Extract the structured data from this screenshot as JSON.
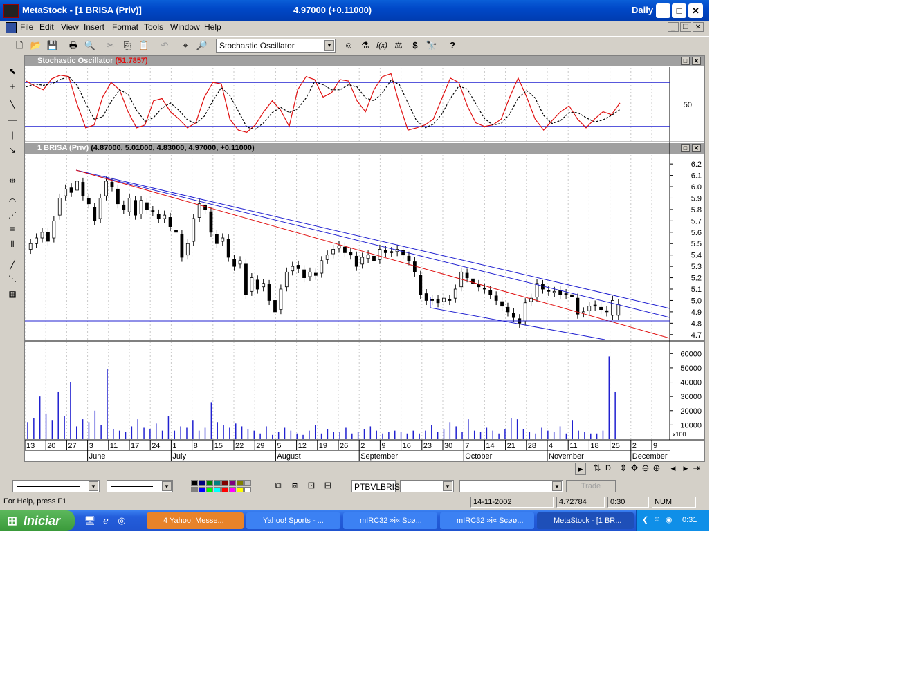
{
  "window": {
    "title": "MetaStock - [1 BRISA (Priv)]",
    "center_text": "4.97000 (+0.11000)",
    "periodicity": "Daily",
    "minimize": "_",
    "maximize": "□",
    "close": "✕"
  },
  "menu": [
    "File",
    "Edit",
    "View",
    "Insert",
    "Format",
    "Tools",
    "Window",
    "Help"
  ],
  "toolbar": {
    "indicator_select": "Stochastic Oscillator",
    "icons": [
      "new-icon",
      "open-icon",
      "save-icon",
      "print-icon",
      "print-preview-icon",
      "cut-icon",
      "copy-icon",
      "paste-icon",
      "undo-icon",
      "crosshair-icon",
      "zoom-icon"
    ],
    "fx_label": "f(x)",
    "dollar_label": "$",
    "help_label": "?"
  },
  "stochastic": {
    "title": "Stochastic Oscillator",
    "value": "(51.7857)",
    "axis_label": "50"
  },
  "price": {
    "title": "1 BRISA (Priv)",
    "values": "(4.87000, 5.01000, 4.83000, 4.97000, +0.11000)",
    "axis_labels": [
      "6.2",
      "6.1",
      "6.0",
      "5.9",
      "5.8",
      "5.7",
      "5.6",
      "5.5",
      "5.4",
      "5.3",
      "5.2",
      "5.1",
      "5.0",
      "4.9",
      "4.8",
      "4.7"
    ]
  },
  "volume": {
    "axis_labels": [
      "60000",
      "50000",
      "40000",
      "30000",
      "20000",
      "10000"
    ],
    "multiplier": "x100"
  },
  "date_axis": {
    "days": [
      "13",
      "20",
      "27",
      "3",
      "11",
      "17",
      "24",
      "1",
      "8",
      "15",
      "22",
      "29",
      "5",
      "12",
      "19",
      "26",
      "2",
      "9",
      "16",
      "23",
      "30",
      "7",
      "14",
      "21",
      "28",
      "4",
      "11",
      "18",
      "25",
      "2",
      "9"
    ],
    "months": [
      "June",
      "July",
      "August",
      "September",
      "October",
      "November",
      "December"
    ]
  },
  "scroll_buttons": [
    "D"
  ],
  "bottom_toolbar": {
    "security_field": "PTBVLBRIS",
    "trade_button": "Trade"
  },
  "status": {
    "help": "For Help, press F1",
    "date": "14-11-2002",
    "value": "4.72784",
    "time": "0:30",
    "num": "NUM"
  },
  "taskbar": {
    "start": "Iniciar",
    "tasks": [
      "4 Yahoo! Messe...",
      "Yahoo! Sports - ...",
      "mIRC32  »i« Scø...",
      "mIRC32  »i« Scøø...",
      "MetaStock - [1 BR..."
    ],
    "clock": "0:31"
  },
  "chart_data": [
    {
      "type": "line",
      "title": "Stochastic Oscillator",
      "ylim": [
        0,
        100
      ],
      "reference_lines": [
        80,
        20
      ],
      "series": [
        {
          "name": "%K",
          "color": "#e01010",
          "values": [
            82,
            75,
            70,
            85,
            90,
            88,
            50,
            18,
            22,
            60,
            80,
            70,
            40,
            18,
            22,
            55,
            58,
            40,
            30,
            18,
            25,
            60,
            80,
            78,
            30,
            15,
            12,
            22,
            40,
            55,
            42,
            20,
            70,
            88,
            84,
            60,
            66,
            84,
            82,
            55,
            40,
            70,
            88,
            92,
            50,
            15,
            18,
            22,
            30,
            58,
            86,
            80,
            48,
            25,
            20,
            22,
            30,
            60,
            86,
            60,
            30,
            15,
            28,
            40,
            48,
            30,
            18,
            30,
            40,
            36,
            52
          ]
        },
        {
          "name": "%D",
          "color": "#000000",
          "values": [
            74,
            78,
            76,
            78,
            84,
            88,
            76,
            52,
            30,
            33,
            54,
            70,
            64,
            42,
            27,
            32,
            45,
            52,
            42,
            29,
            24,
            34,
            55,
            73,
            62,
            41,
            19,
            16,
            25,
            39,
            46,
            39,
            44,
            59,
            81,
            77,
            70,
            70,
            77,
            74,
            59,
            55,
            66,
            83,
            77,
            52,
            28,
            18,
            23,
            37,
            58,
            75,
            71,
            51,
            31,
            22,
            24,
            37,
            59,
            69,
            59,
            35,
            24,
            28,
            39,
            39,
            32,
            26,
            29,
            35,
            43
          ]
        }
      ]
    },
    {
      "type": "candlestick",
      "title": "1 BRISA (Priv)",
      "ylim": [
        4.65,
        6.28
      ],
      "x": [
        "2002-06-13",
        "2002-06-14",
        "2002-06-17",
        "2002-06-18",
        "2002-06-19",
        "2002-06-20",
        "2002-06-21",
        "2002-06-24",
        "2002-06-25",
        "2002-06-26",
        "2002-06-27",
        "2002-06-28",
        "2002-07-01",
        "2002-07-02",
        "2002-07-03",
        "2002-07-04",
        "2002-07-05",
        "2002-07-08",
        "2002-07-09",
        "2002-07-10",
        "2002-07-11",
        "2002-07-12",
        "2002-07-15",
        "2002-07-16",
        "2002-07-17",
        "2002-07-18",
        "2002-07-19",
        "2002-07-22",
        "2002-07-23",
        "2002-07-24",
        "2002-07-25",
        "2002-07-26",
        "2002-07-29",
        "2002-07-30",
        "2002-07-31",
        "2002-08-01",
        "2002-08-02",
        "2002-08-05",
        "2002-08-06",
        "2002-08-07",
        "2002-08-08",
        "2002-08-09",
        "2002-08-12",
        "2002-08-13",
        "2002-08-14",
        "2002-08-15",
        "2002-08-16",
        "2002-08-19",
        "2002-08-20",
        "2002-08-21",
        "2002-08-22",
        "2002-08-23",
        "2002-08-26",
        "2002-08-27",
        "2002-08-28",
        "2002-08-29",
        "2002-08-30",
        "2002-09-02",
        "2002-09-03",
        "2002-09-04",
        "2002-09-05",
        "2002-09-06",
        "2002-09-09",
        "2002-09-10",
        "2002-09-11",
        "2002-09-12",
        "2002-09-13",
        "2002-09-16",
        "2002-09-17",
        "2002-09-18",
        "2002-09-19",
        "2002-09-20",
        "2002-09-23",
        "2002-09-24",
        "2002-09-25",
        "2002-09-26",
        "2002-09-27",
        "2002-09-30",
        "2002-10-01",
        "2002-10-02",
        "2002-10-03",
        "2002-10-04",
        "2002-10-07",
        "2002-10-08",
        "2002-10-09",
        "2002-10-10",
        "2002-10-11",
        "2002-10-14",
        "2002-10-15",
        "2002-10-16",
        "2002-10-17",
        "2002-10-18",
        "2002-10-21",
        "2002-10-22",
        "2002-10-23",
        "2002-10-24",
        "2002-10-25",
        "2002-10-28",
        "2002-10-29",
        "2002-10-30",
        "2002-10-31",
        "2002-11-01",
        "2002-11-04",
        "2002-11-05",
        "2002-11-06",
        "2002-11-07",
        "2002-11-08",
        "2002-11-11",
        "2002-11-12",
        "2002-11-13",
        "2002-11-14",
        "2002-11-15",
        "2002-11-18",
        "2002-11-19",
        "2002-11-20",
        "2002-11-21",
        "2002-11-22",
        "2002-11-25",
        "2002-11-26"
      ],
      "close": [
        5.5,
        5.55,
        5.6,
        5.52,
        5.7,
        5.9,
        5.98,
        5.95,
        6.05,
        5.92,
        5.85,
        5.7,
        5.9,
        6.05,
        6.0,
        5.85,
        5.8,
        5.9,
        5.75,
        5.88,
        5.8,
        5.78,
        5.72,
        5.75,
        5.65,
        5.6,
        5.38,
        5.5,
        5.72,
        5.85,
        5.8,
        5.6,
        5.5,
        5.55,
        5.38,
        5.3,
        5.35,
        5.05,
        5.2,
        5.1,
        5.15,
        5.0,
        4.9,
        5.1,
        5.25,
        5.3,
        5.28,
        5.2,
        5.25,
        5.22,
        5.35,
        5.4,
        5.45,
        5.48,
        5.42,
        5.4,
        5.3,
        5.38,
        5.4,
        5.35,
        5.45,
        5.42,
        5.42,
        5.45,
        5.4,
        5.35,
        5.25,
        5.05,
        5.0,
        5.0,
        4.98,
        5.02,
        5.0,
        5.1,
        5.25,
        5.2,
        5.15,
        5.12,
        5.1,
        5.05,
        5.0,
        4.95,
        4.9,
        4.85,
        4.8,
        4.98,
        5.02,
        5.15,
        5.1,
        5.08,
        5.08,
        5.05,
        5.05,
        5.03,
        4.88,
        4.9,
        4.95,
        4.95,
        4.92,
        4.9,
        5.0,
        4.97
      ],
      "open": [
        5.45,
        5.5,
        5.55,
        5.6,
        5.55,
        5.75,
        5.92,
        5.99,
        5.97,
        6.04,
        5.9,
        5.82,
        5.72,
        5.92,
        6.04,
        5.98,
        5.84,
        5.78,
        5.88,
        5.76,
        5.86,
        5.79,
        5.76,
        5.72,
        5.73,
        5.62,
        5.58,
        5.4,
        5.52,
        5.73,
        5.84,
        5.78,
        5.58,
        5.52,
        5.54,
        5.36,
        5.32,
        5.32,
        5.08,
        5.18,
        5.12,
        5.14,
        5.0,
        4.92,
        5.12,
        5.26,
        5.31,
        5.27,
        5.21,
        5.24,
        5.24,
        5.36,
        5.41,
        5.46,
        5.47,
        5.42,
        5.39,
        5.32,
        5.37,
        5.39,
        5.36,
        5.44,
        5.43,
        5.43,
        5.44,
        5.39,
        5.34,
        5.22,
        5.06,
        5.01,
        5.01,
        4.99,
        5.01,
        5.02,
        5.12,
        5.24,
        5.19,
        5.14,
        5.11,
        5.09,
        5.04,
        4.99,
        4.94,
        4.89,
        4.84,
        4.82,
        4.99,
        5.03,
        5.14,
        5.09,
        5.07,
        5.09,
        5.06,
        5.05,
        5.02,
        4.89,
        4.91,
        4.96,
        4.94,
        4.91,
        4.87,
        4.87
      ]
    },
    {
      "type": "bar",
      "title": "Volume",
      "ylim": [
        0,
        65000
      ],
      "values": [
        12000,
        15000,
        30000,
        18000,
        13000,
        33000,
        16000,
        40000,
        9000,
        14000,
        12000,
        20000,
        10000,
        49000,
        7000,
        6000,
        5000,
        9000,
        14000,
        8000,
        7000,
        11000,
        6000,
        16000,
        6000,
        9000,
        8000,
        13000,
        6000,
        8000,
        26000,
        12000,
        10000,
        8000,
        11000,
        9000,
        7000,
        6000,
        4000,
        9000,
        3000,
        5000,
        8000,
        6000,
        4000,
        3000,
        6000,
        10000,
        4000,
        7000,
        5000,
        5000,
        8000,
        4000,
        5000,
        7000,
        9000,
        6000,
        4000,
        5000,
        6000,
        5000,
        4000,
        6000,
        4000,
        6000,
        10000,
        5000,
        7000,
        12000,
        9000,
        5000,
        14000,
        6000,
        5000,
        8000,
        6000,
        4000,
        7000,
        15000,
        14000,
        7000,
        5000,
        4000,
        8000,
        6000,
        5000,
        9000,
        4000,
        13000,
        6000,
        5000,
        4000,
        4000,
        6000,
        58000,
        33000
      ]
    }
  ]
}
